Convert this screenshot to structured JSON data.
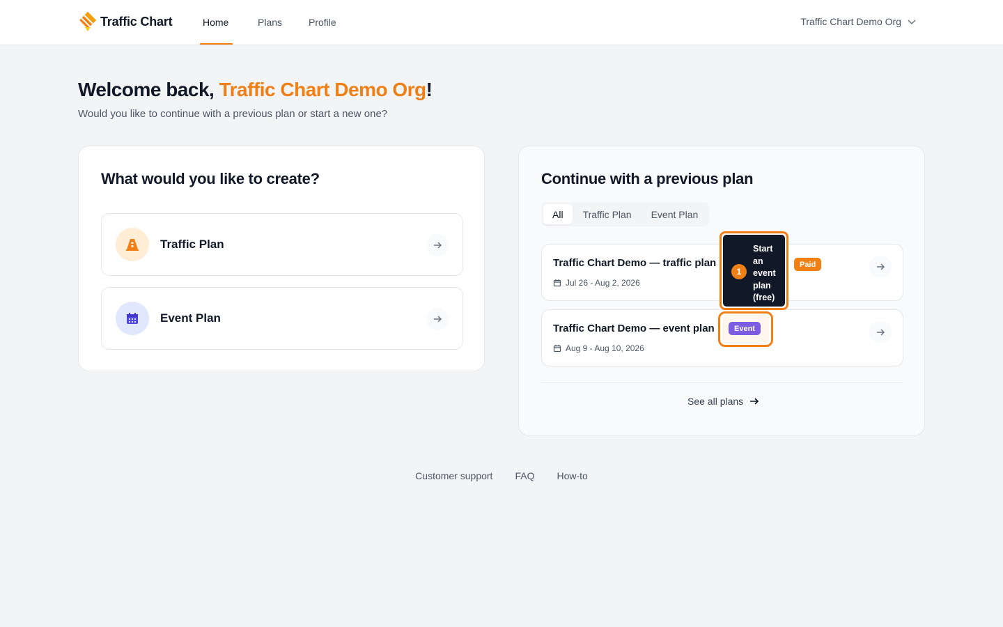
{
  "header": {
    "brand": "Traffic Chart",
    "nav": [
      {
        "label": "Home",
        "active": true
      },
      {
        "label": "Plans",
        "active": false
      },
      {
        "label": "Profile",
        "active": false
      }
    ],
    "org_selector": "Traffic Chart Demo Org"
  },
  "welcome": {
    "prefix": "Welcome back, ",
    "org": "Traffic Chart Demo Org",
    "suffix": "!",
    "subtitle": "Would you like to continue with a previous plan or start a new one?"
  },
  "create": {
    "title": "What would you like to create?",
    "items": [
      {
        "label": "Traffic Plan",
        "icon": "traffic-cone-icon"
      },
      {
        "label": "Event Plan",
        "icon": "calendar-icon"
      }
    ]
  },
  "previous": {
    "title": "Continue with a previous plan",
    "tabs": [
      "All",
      "Traffic Plan",
      "Event Plan"
    ],
    "plans": [
      {
        "name": "Traffic Chart Demo — traffic plan",
        "date": "Jul 26 - Aug 2, 2026",
        "badge": "Paid"
      },
      {
        "name": "Traffic Chart Demo — event plan",
        "date": "Aug 9 - Aug 10, 2026",
        "badge": "Event"
      }
    ],
    "see_all": "See all plans"
  },
  "tooltip": {
    "step": "1",
    "text": "Start an event plan (free)"
  },
  "footer": {
    "links": [
      "Customer support",
      "FAQ",
      "How-to"
    ]
  },
  "colors": {
    "accent": "#f07f16",
    "event_badge": "#7c5ce0",
    "dark": "#111827"
  }
}
